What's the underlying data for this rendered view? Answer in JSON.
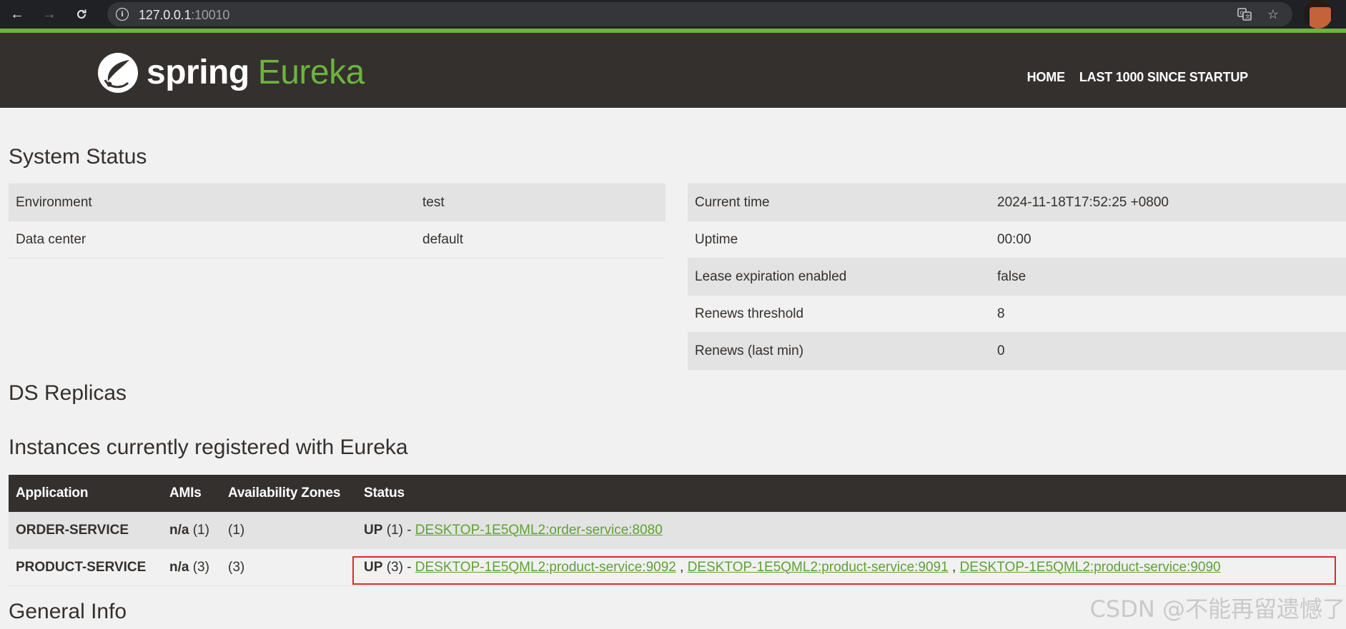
{
  "browser": {
    "url_host": "127.0.0.1",
    "url_port": ":10010",
    "back_icon": "arrow-left",
    "forward_icon": "arrow-right",
    "reload_icon": "reload",
    "info_icon": "info",
    "translate_icon": "translate",
    "bookmark_icon": "star"
  },
  "navbar": {
    "logo_spring": "spring",
    "logo_eureka": "Eureka",
    "links": [
      "HOME",
      "LAST 1000 SINCE STARTUP"
    ],
    "accent_color": "#6db33f",
    "bg_color": "#34302d"
  },
  "system_status": {
    "title": "System Status",
    "left": [
      {
        "label": "Environment",
        "value": "test"
      },
      {
        "label": "Data center",
        "value": "default"
      }
    ],
    "right": [
      {
        "label": "Current time",
        "value": "2024-11-18T17:52:25 +0800"
      },
      {
        "label": "Uptime",
        "value": "00:00"
      },
      {
        "label": "Lease expiration enabled",
        "value": "false"
      },
      {
        "label": "Renews threshold",
        "value": "8"
      },
      {
        "label": "Renews (last min)",
        "value": "0"
      }
    ]
  },
  "ds_replicas": {
    "title": "DS Replicas"
  },
  "instances": {
    "title": "Instances currently registered with Eureka",
    "columns": [
      "Application",
      "AMIs",
      "Availability Zones",
      "Status"
    ],
    "rows": [
      {
        "application": "ORDER-SERVICE",
        "ami_na": "n/a",
        "ami_count": "(1)",
        "zones": "(1)",
        "status_up": "UP",
        "status_count": "(1) - ",
        "links": [
          "DESKTOP-1E5QML2:order-service:8080"
        ]
      },
      {
        "application": "PRODUCT-SERVICE",
        "ami_na": "n/a",
        "ami_count": "(3)",
        "zones": "(3)",
        "status_up": "UP",
        "status_count": "(3) - ",
        "links": [
          "DESKTOP-1E5QML2:product-service:9092",
          "DESKTOP-1E5QML2:product-service:9091",
          "DESKTOP-1E5QML2:product-service:9090"
        ],
        "separator": " , "
      }
    ]
  },
  "general_info": {
    "title": "General Info"
  },
  "watermark": "CSDN @不能再留遗憾了"
}
